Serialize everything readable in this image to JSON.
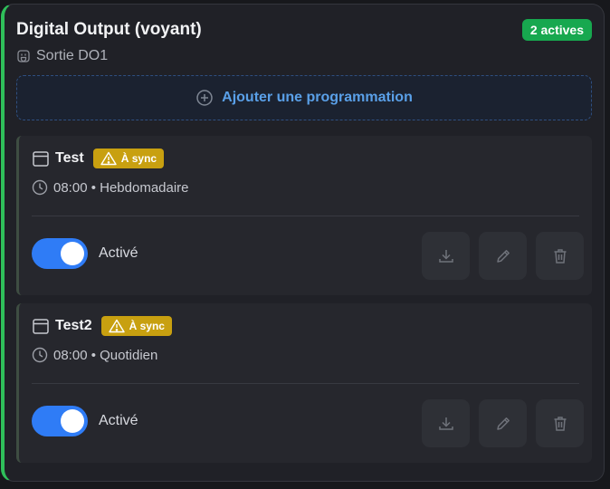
{
  "header": {
    "title": "Digital Output (voyant)",
    "subtitle": "Sortie DO1",
    "active_badge": "2 actives"
  },
  "add_button": {
    "label": "Ajouter une programmation"
  },
  "schedules": [
    {
      "name": "Test",
      "sync_badge": "À sync",
      "time": "08:00 • Hebdomadaire",
      "toggle_label": "Activé",
      "enabled": true
    },
    {
      "name": "Test2",
      "sync_badge": "À sync",
      "time": "08:00 • Quotidien",
      "toggle_label": "Activé",
      "enabled": true
    }
  ],
  "colors": {
    "accent_green": "#2fbf5a",
    "badge_green": "#17a84f",
    "link_blue": "#5aa0e8",
    "toggle_blue": "#2f7cf6",
    "warning_yellow": "#c8a010"
  },
  "icons": {
    "subtitle": "plug-icon",
    "add": "plus-circle-icon",
    "schedule": "calendar-icon",
    "sync": "warning-icon",
    "time": "clock-icon",
    "actions": [
      "download-icon",
      "pencil-icon",
      "trash-icon"
    ]
  }
}
